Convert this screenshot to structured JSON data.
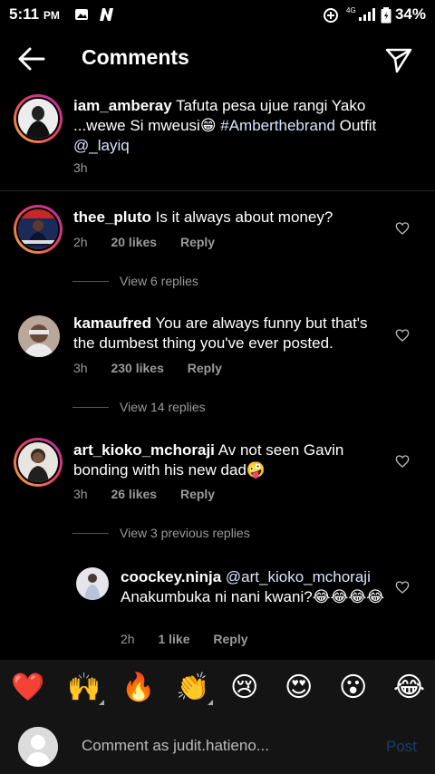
{
  "status_bar": {
    "time": "5:11",
    "ampm": "PM",
    "battery": "34%",
    "network": "4G"
  },
  "header": {
    "title": "Comments"
  },
  "caption": {
    "username": "iam_amberay",
    "text": " Tafuta pesa ujue rangi Yako ...wewe Si mweusi😁 ",
    "hashtag": "#Amberthebrand",
    "text2": " Outfit ",
    "mention": "@_layiq",
    "time": "3h"
  },
  "comments": [
    {
      "username": "thee_pluto",
      "text": " Is it always about money?",
      "time": "2h",
      "likes": "20 likes",
      "reply": "Reply",
      "view_replies": "View 6 replies"
    },
    {
      "username": "kamaufred",
      "text": " You are always funny but that's the dumbest thing you've ever posted.",
      "time": "3h",
      "likes": "230 likes",
      "reply": "Reply",
      "view_replies": "View 14 replies"
    },
    {
      "username": "art_kioko_mchoraji",
      "text": " Av not seen Gavin bonding with his new dad🤪",
      "time": "3h",
      "likes": "26 likes",
      "reply": "Reply",
      "view_replies": "View 3 previous replies"
    }
  ],
  "nested_reply": {
    "username": "coockey.ninja",
    "mention": " @art_kioko_mchoraji",
    "text": " Anakumbuka ni nani kwani?😂😂😂😂",
    "time": "2h",
    "likes": "1 like",
    "reply": "Reply"
  },
  "emoji_bar": [
    "❤️",
    "🙌",
    "🔥",
    "👏",
    "😢",
    "😍",
    "😮",
    "😂"
  ],
  "composer": {
    "placeholder": "Comment as judit.hatieno...",
    "post": "Post"
  }
}
